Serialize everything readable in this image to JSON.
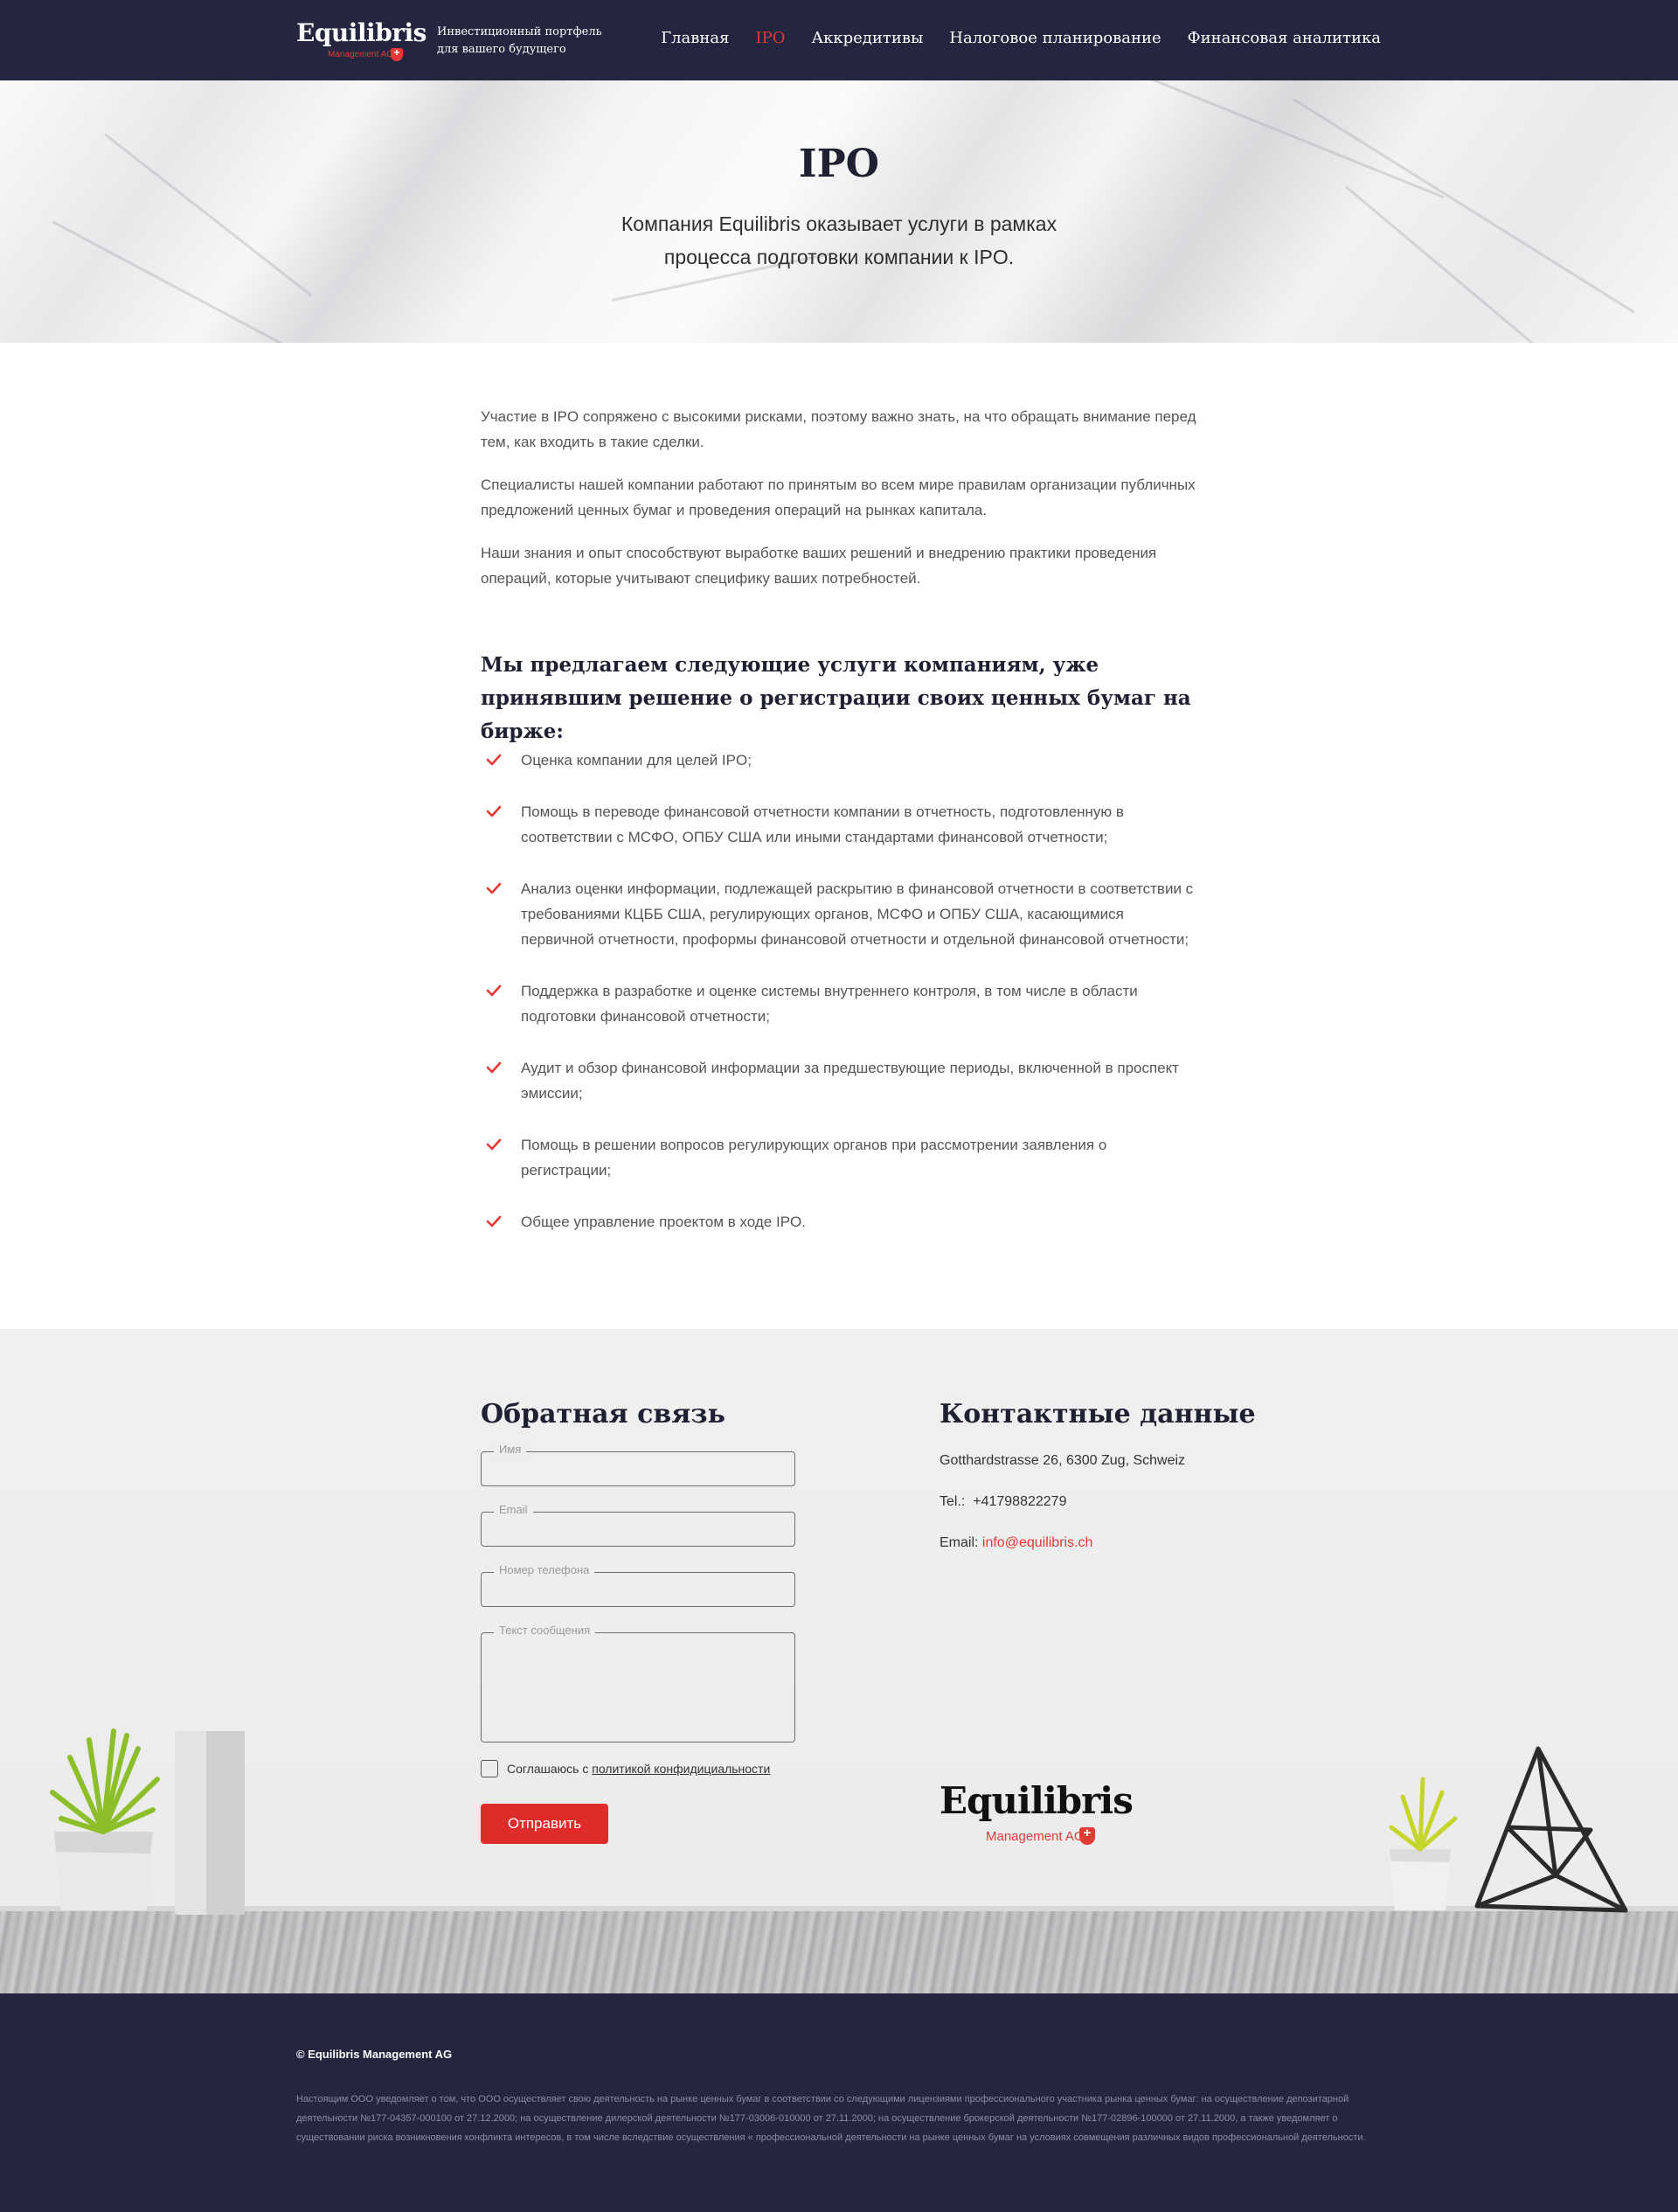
{
  "header": {
    "logo_text": "Equilibris",
    "logo_sub": "Management AG",
    "tagline": "Инвестиционный портфель для вашего будущего",
    "nav": [
      {
        "label": "Главная",
        "active": false
      },
      {
        "label": "IPO",
        "active": true
      },
      {
        "label": "Аккредитивы",
        "active": false
      },
      {
        "label": "Налоговое планирование",
        "active": false
      },
      {
        "label": "Финансовая аналитика",
        "active": false
      }
    ]
  },
  "hero": {
    "title": "IPO",
    "subtitle": "Компания Equilibris оказывает услуги в рамках процесса подготовки компании к IPO."
  },
  "intro": [
    "Участие в IPO сопряжено с высокими рисками, поэтому важно знать, на что обращать внимание перед тем, как входить в такие сделки.",
    "Специалисты нашей компании работают по принятым во всем мире правилам организации публичных предложений ценных бумаг и проведения операций на рынках капитала.",
    "Наши знания и опыт способствуют выработке ваших решений и внедрению практики проведения операций, которые учитывают специфику ваших потребностей."
  ],
  "services": {
    "title": "Мы предлагаем следующие услуги компаниям, уже принявшим решение о регистрации своих ценных бумаг на бирже:",
    "items": [
      "Оценка компании для целей IPO;",
      "Помощь в переводе финансовой отчетности компании в отчетность, подготовленную в соответствии с МСФО, ОПБУ США или иными стандартами финансовой отчетности;",
      "Анализ оценки информации, подлежащей раскрытию в финансовой отчетности в соответствии с требованиями КЦББ США, регулирующих органов, МСФО и ОПБУ США, касающимися первичной отчетности, проформы финансовой отчетности и отдельной финансовой отчетности;",
      "Поддержка в разработке и оценке системы внутреннего контроля, в том числе в области подготовки финансовой отчетности;",
      "Аудит и обзор финансовой информации за предшествующие периоды, включенной в проспект эмиссии;",
      "Помощь в решении вопросов регулирующих органов при рассмотрении заявления о регистрации;",
      "Общее управление проектом в ходе IPO."
    ],
    "check_color": "#e53935"
  },
  "feedback": {
    "title": "Обратная связь",
    "name_label": "Имя",
    "email_label": "Email",
    "phone_label": "Номер телефона",
    "message_label": "Текст сообщения",
    "consent_text": "Соглашаюсь с",
    "policy_link": "политикой конфидициальности",
    "submit": "Отправить"
  },
  "contacts": {
    "title": "Контактные данные",
    "address": "Gotthardstrasse 26, 6300 Zug, Schweiz",
    "phone_prefix": "Tel.:",
    "phone": "+41798822279",
    "email_prefix": "Email:",
    "email": "info@equilibris.ch"
  },
  "footer": {
    "copyright": "© Equilibris Management AG",
    "legal": "Настоящим ООО уведомляет о том, что ООО осуществляет свою деятельность на рынке ценных бумаг в соответствии со следующими лицензиями профессионального участника рынка ценных бумаг: на осуществление депозитарной деятельности №177-04357-000100 от 27.12.2000; на осуществление дилерской деятельности №177-03006-010000 от 27.11.2000; на осуществление брокерской деятельности №177-02896-100000 от 27.11.2000, а также уведомляет о существовании риска возникновения конфликта интересов, в том числе вследствие осуществления « профессиональной деятельности на рынке ценных бумаг на условиях совмещения различных видов профессиональной деятельности."
  },
  "colors": {
    "header_bg": "#24263f",
    "accent": "#e53935",
    "button": "#e02b2b"
  }
}
